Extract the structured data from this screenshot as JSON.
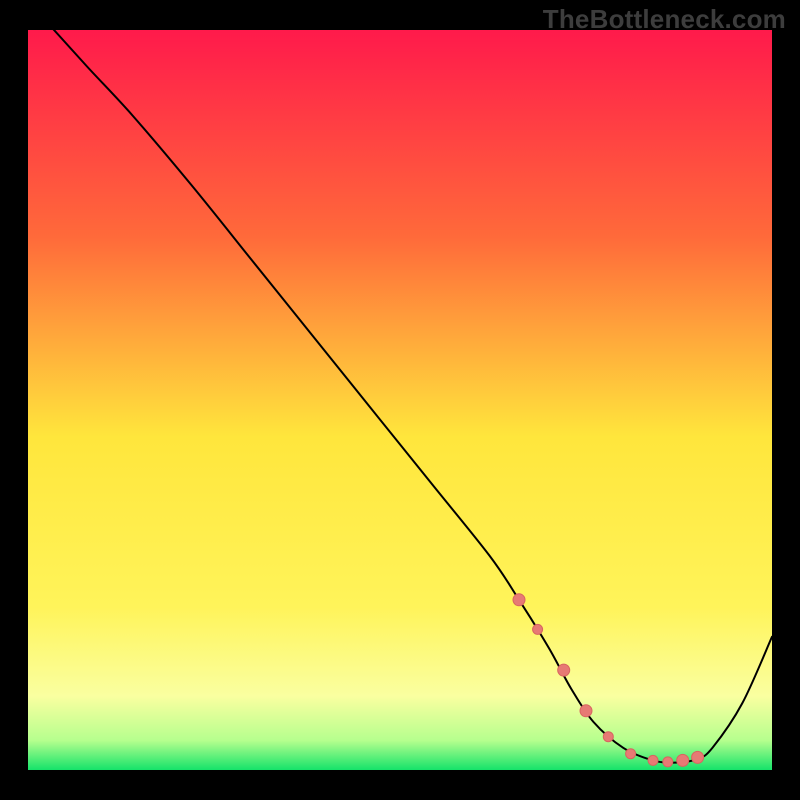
{
  "watermark": "TheBottleneck.com",
  "colors": {
    "frame": "#000000",
    "line": "#000000",
    "marker_fill": "#e77a74",
    "marker_stroke": "#d86560",
    "gradient": {
      "top_red": "#ff1a4b",
      "mid_orange": "#ff8a3a",
      "mid_yellow": "#ffe63c",
      "pale_yellow": "#fff77a",
      "bottom_green": "#15e36a"
    }
  },
  "chart_data": {
    "type": "line",
    "title": "",
    "xlabel": "",
    "ylabel": "",
    "xlim": [
      0,
      100
    ],
    "ylim": [
      0,
      100
    ],
    "series": [
      {
        "name": "bottleneck-curve",
        "x": [
          0,
          3.5,
          8,
          14,
          22,
          30,
          38,
          46,
          54,
          62,
          66,
          70,
          73,
          76,
          80,
          84,
          87,
          90,
          92,
          96,
          100
        ],
        "y": [
          104,
          100,
          95,
          88.5,
          79,
          69,
          59,
          49,
          39,
          29,
          23,
          16.5,
          11,
          6.5,
          3,
          1.3,
          1,
          1.5,
          3,
          9,
          18
        ]
      }
    ],
    "markers": {
      "name": "highlight-points",
      "x": [
        66,
        68.5,
        72,
        75,
        78,
        81,
        84,
        86,
        88,
        90
      ],
      "y": [
        23,
        19,
        13.5,
        8,
        4.5,
        2.2,
        1.3,
        1.1,
        1.3,
        1.7
      ],
      "r": [
        6,
        5,
        6,
        6,
        5,
        5,
        5,
        5,
        6,
        6
      ]
    }
  }
}
